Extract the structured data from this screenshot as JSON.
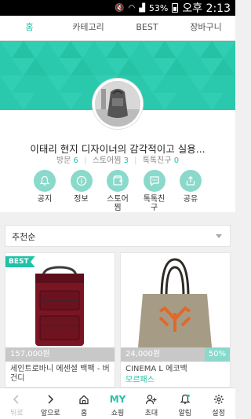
{
  "status_bar": {
    "battery": "53%",
    "time": "오후 2:13"
  },
  "tabs": [
    {
      "label": "홈"
    },
    {
      "label": "카테고리"
    },
    {
      "label": "BEST"
    },
    {
      "label": "장바구니"
    }
  ],
  "profile": {
    "store_name": "이태리 현지 디자이너의 감각적이고 실용...",
    "stats": [
      {
        "label": "방문",
        "value": "6"
      },
      {
        "label": "스토어찜",
        "value": "3"
      },
      {
        "label": "톡톡친구",
        "value": "0"
      }
    ]
  },
  "actions": [
    {
      "label": "공지",
      "icon": "bell-icon"
    },
    {
      "label": "정보",
      "icon": "info-icon"
    },
    {
      "label": "스토어찜",
      "icon": "store-bookmark-icon"
    },
    {
      "label": "톡톡친구",
      "icon": "chat-icon"
    },
    {
      "label": "공유",
      "icon": "share-icon"
    }
  ],
  "sort": {
    "selected": "추천순"
  },
  "products": [
    {
      "badge": "BEST",
      "price": "157,000원",
      "title": "세인트로바니 에센셜 백팩 - 버건디",
      "discount": ""
    },
    {
      "badge": "",
      "price": "24,000원",
      "title": "CINEMA L 에코백",
      "sub": "모르패스",
      "discount": "50%"
    }
  ],
  "bottom_nav": [
    {
      "label": "뒤로",
      "icon": "back-arrow-icon"
    },
    {
      "label": "앞으로",
      "icon": "forward-arrow-icon"
    },
    {
      "label": "홈",
      "icon": "home-icon"
    },
    {
      "label": "쇼핑",
      "icon": "my-shopping-icon",
      "mark": "MY"
    },
    {
      "label": "초대",
      "icon": "invite-user-icon"
    },
    {
      "label": "알림",
      "icon": "bell-icon"
    },
    {
      "label": "설정",
      "icon": "gear-icon"
    }
  ],
  "colors": {
    "accent": "#22c4a8",
    "banner": "#2ac9ad",
    "icon_circle": "#8ad9cb"
  }
}
